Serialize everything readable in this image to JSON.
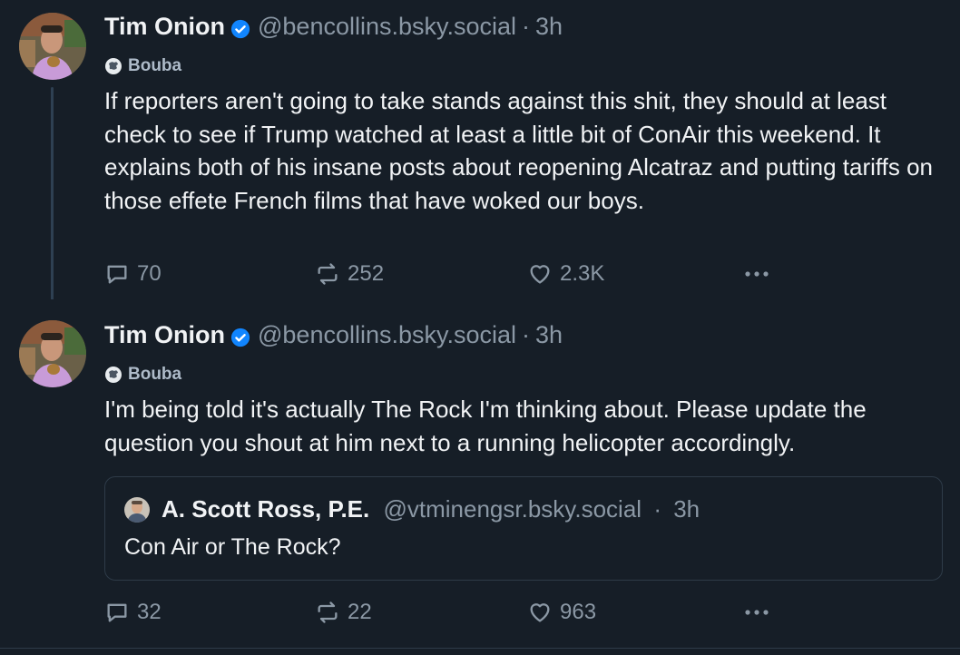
{
  "posts": [
    {
      "author_name": "Tim Onion",
      "handle": "@bencollins.bsky.social",
      "separator": "·",
      "time": "3h",
      "label": "Bouba",
      "text": "If reporters aren't going to take stands against this shit, they should at least check to see if Trump watched at least a little bit of ConAir this weekend. It explains both of his insane posts about reopening Alcatraz and putting tariffs on those effete French films that have woked our boys.",
      "replies": "70",
      "reposts": "252",
      "likes": "2.3K"
    },
    {
      "author_name": "Tim Onion",
      "handle": "@bencollins.bsky.social",
      "separator": "·",
      "time": "3h",
      "label": "Bouba",
      "text": "I'm being told it's actually The Rock I'm thinking about. Please update the question you shout at him next to a running helicopter accordingly.",
      "quote": {
        "author_name": "A. Scott Ross, P.E.",
        "handle": "@vtminengsr.bsky.social",
        "separator": "·",
        "time": "3h",
        "text": "Con Air or The Rock?"
      },
      "replies": "32",
      "reposts": "22",
      "likes": "963"
    }
  ],
  "colors": {
    "background": "#161e27",
    "text": "#f1f3f5",
    "muted": "#8b98a5",
    "verified": "#1185fe"
  }
}
